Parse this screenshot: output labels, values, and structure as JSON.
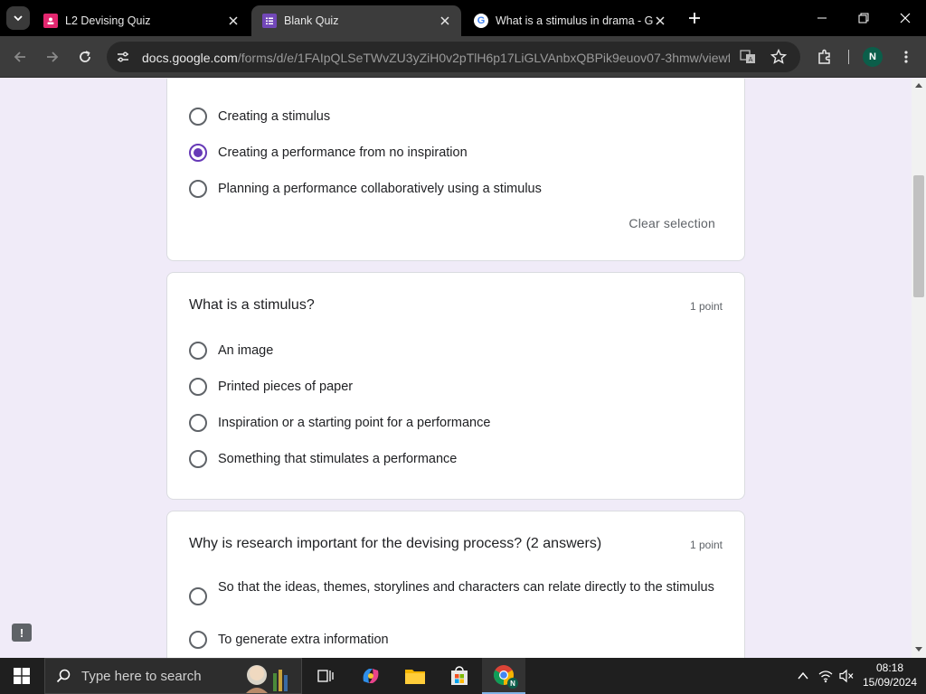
{
  "tabs": [
    {
      "title": "L2 Devising Quiz",
      "active": false
    },
    {
      "title": "Blank Quiz",
      "active": true
    },
    {
      "title": "What is a stimulus in drama - G",
      "active": false
    }
  ],
  "address": {
    "host": "docs.google.com",
    "path": "/forms/d/e/1FAIpQLSeTWvZU3yZiH0v2pTlH6p17LiGLVAnbxQBPik9euov07-3hmw/viewf..."
  },
  "profile": {
    "initial": "N"
  },
  "form": {
    "card1": {
      "options": [
        {
          "label": "Creating a stimulus",
          "selected": false
        },
        {
          "label": "Creating a performance from no inspiration",
          "selected": true
        },
        {
          "label": "Planning a performance collaboratively using a stimulus",
          "selected": false
        }
      ],
      "clear_label": "Clear selection"
    },
    "card2": {
      "title": "What is a stimulus?",
      "points": "1 point",
      "options": [
        {
          "label": "An image"
        },
        {
          "label": "Printed pieces of paper"
        },
        {
          "label": "Inspiration or a starting point for a performance"
        },
        {
          "label": "Something that stimulates a performance"
        }
      ]
    },
    "card3": {
      "title": "Why is research important for the devising process? (2 answers)",
      "points": "1 point",
      "options": [
        {
          "label": "So that the ideas, themes, storylines and characters can relate directly to the stimulus"
        },
        {
          "label": "To generate extra information"
        }
      ]
    }
  },
  "feedback": {
    "glyph": "!"
  },
  "taskbar": {
    "search_placeholder": "Type here to search",
    "time": "08:18",
    "date": "15/09/2024",
    "chrome_badge": "N"
  },
  "colors": {
    "accent": "#673ab7",
    "page_bg": "#f0ebf8"
  }
}
